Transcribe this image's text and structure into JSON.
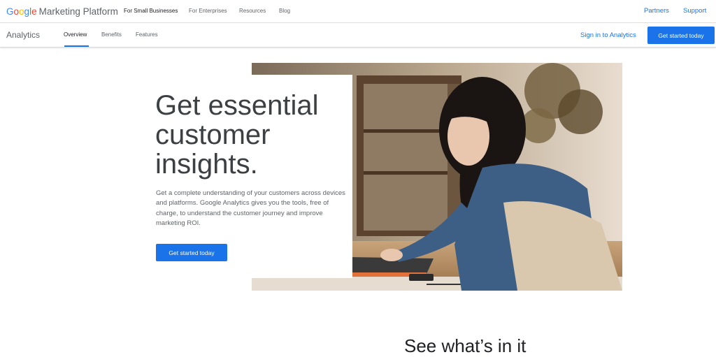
{
  "topbar": {
    "logo_google": "Google",
    "logo_platform": "Marketing Platform",
    "nav": [
      "For Small Businesses",
      "For Enterprises",
      "Resources",
      "Blog"
    ],
    "links": [
      "Partners",
      "Support"
    ]
  },
  "subbar": {
    "product": "Analytics",
    "tabs": [
      "Overview",
      "Benefits",
      "Features"
    ],
    "signin": "Sign in to Analytics",
    "cta": "Get started today"
  },
  "hero": {
    "title": "Get essential customer insights.",
    "body": "Get a complete understanding of your customers across devices and platforms. Google Analytics gives you the tools, free of charge, to understand the customer journey and improve marketing ROI.",
    "cta": "Get started today"
  },
  "next_section": {
    "heading": "See what’s in it"
  },
  "colors": {
    "accent": "#1a73e8",
    "google_blue": "#4285F4",
    "google_red": "#EA4335",
    "google_yellow": "#FBBC05",
    "google_green": "#34A853"
  }
}
